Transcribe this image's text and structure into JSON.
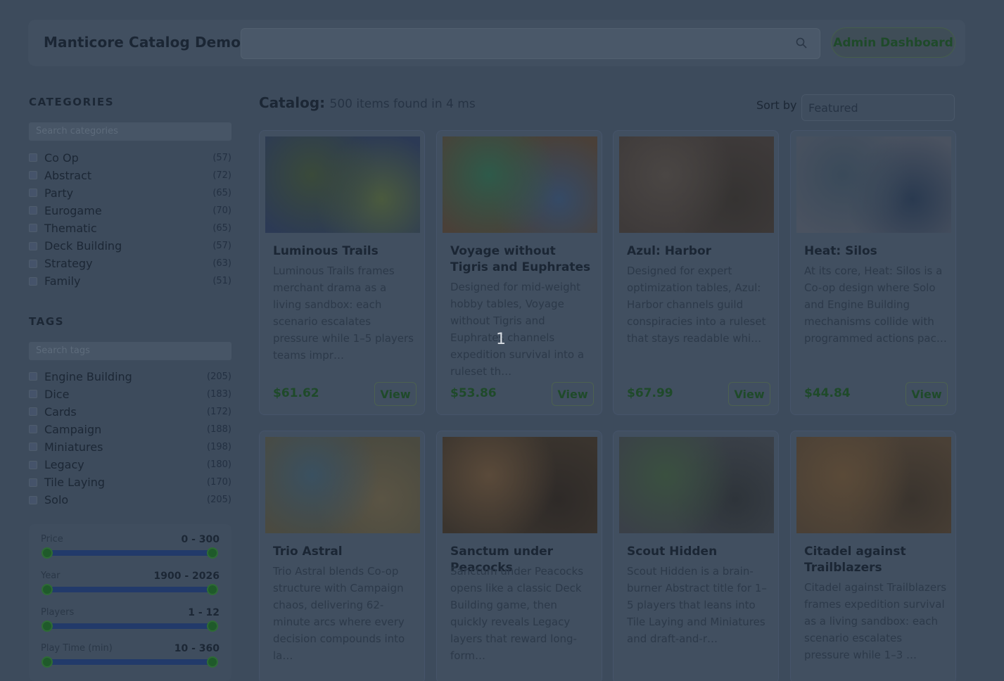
{
  "header": {
    "brand": "Manticore Catalog Demo",
    "search_value": "",
    "search_icon": "search-icon",
    "admin_label": "Admin Dashboard"
  },
  "sidebar": {
    "categories_heading": "CATEGORIES",
    "categories_search_placeholder": "Search categories",
    "categories": [
      {
        "label": "Co Op",
        "count": "(57)"
      },
      {
        "label": "Abstract",
        "count": "(72)"
      },
      {
        "label": "Party",
        "count": "(65)"
      },
      {
        "label": "Eurogame",
        "count": "(70)"
      },
      {
        "label": "Thematic",
        "count": "(65)"
      },
      {
        "label": "Deck Building",
        "count": "(57)"
      },
      {
        "label": "Strategy",
        "count": "(63)"
      },
      {
        "label": "Family",
        "count": "(51)"
      }
    ],
    "tags_heading": "TAGS",
    "tags_search_placeholder": "Search tags",
    "tags": [
      {
        "label": "Engine Building",
        "count": "(205)"
      },
      {
        "label": "Dice",
        "count": "(183)"
      },
      {
        "label": "Cards",
        "count": "(172)"
      },
      {
        "label": "Campaign",
        "count": "(188)"
      },
      {
        "label": "Miniatures",
        "count": "(198)"
      },
      {
        "label": "Legacy",
        "count": "(180)"
      },
      {
        "label": "Tile Laying",
        "count": "(170)"
      },
      {
        "label": "Solo",
        "count": "(205)"
      }
    ],
    "ranges": [
      {
        "label": "Price",
        "value": "0 - 300"
      },
      {
        "label": "Year",
        "value": "1900 - 2026"
      },
      {
        "label": "Players",
        "value": "1 - 12"
      },
      {
        "label": "Play Time (min)",
        "value": "10 - 360"
      }
    ]
  },
  "catalog": {
    "title": "Catalog:",
    "summary": "500 items found in 4 ms",
    "sort_label": "Sort by",
    "sort_value": "Featured",
    "view_label": "View",
    "overlay_text": "1",
    "products": [
      {
        "name": "Luminous Trails",
        "desc": "Luminous Trails frames merchant drama as a living sandbox: each scenario escalates pressure while 1–5 players teams impr…",
        "price": "$61.62",
        "palette": [
          "#2c3a55",
          "#3a4a3a",
          "#4a5a3e"
        ]
      },
      {
        "name": "Voyage without Tigris and Euphrates",
        "desc": "Designed for mid-weight hobby tables, Voyage without Tigris and Euphrates channels expedition survival into a ruleset th…",
        "price": "$53.86",
        "palette": [
          "#4a4038",
          "#2e5a4a",
          "#354a66"
        ]
      },
      {
        "name": "Azul: Harbor",
        "desc": "Designed for expert optimization tables, Azul: Harbor channels guild conspiracies into a ruleset that stays readable whi…",
        "price": "$67.99",
        "palette": [
          "#3e3a3a",
          "#4a4644",
          "#353332"
        ]
      },
      {
        "name": "Heat: Silos",
        "desc": "At its core, Heat: Silos is a Co-op design where Solo and Engine Building mechanisms collide with programmed actions pac…",
        "price": "$44.84",
        "palette": [
          "#4a5260",
          "#3a4a5a",
          "#2a3a50"
        ]
      },
      {
        "name": "Trio Astral",
        "desc": "Trio Astral blends Co-op structure with Campaign chaos, delivering 62-minute arcs where every decision compounds into la…",
        "price": "",
        "palette": [
          "#4a4a40",
          "#3a5060",
          "#5a5444"
        ]
      },
      {
        "name": "Sanctum under Peacocks",
        "desc": "Sanctum under Peacocks opens like a classic Deck Building game, then quickly reveals Legacy layers that reward long-form…",
        "price": "",
        "palette": [
          "#3a342e",
          "#5a4a3a",
          "#2e2a28"
        ]
      },
      {
        "name": "Scout Hidden",
        "desc": "Scout Hidden is a brain-burner Abstract title for 1–5 players that leans into Tile Laying and Miniatures and draft-and-r…",
        "price": "",
        "palette": [
          "#3a4048",
          "#3a5040",
          "#2e343a"
        ]
      },
      {
        "name": "Citadel against Trailblazers",
        "desc": "Citadel against Trailblazers frames expedition survival as a living sandbox: each scenario escalates pressure while 1–3 …",
        "price": "",
        "palette": [
          "#4a4036",
          "#5a4a38",
          "#3a342e"
        ]
      }
    ]
  }
}
